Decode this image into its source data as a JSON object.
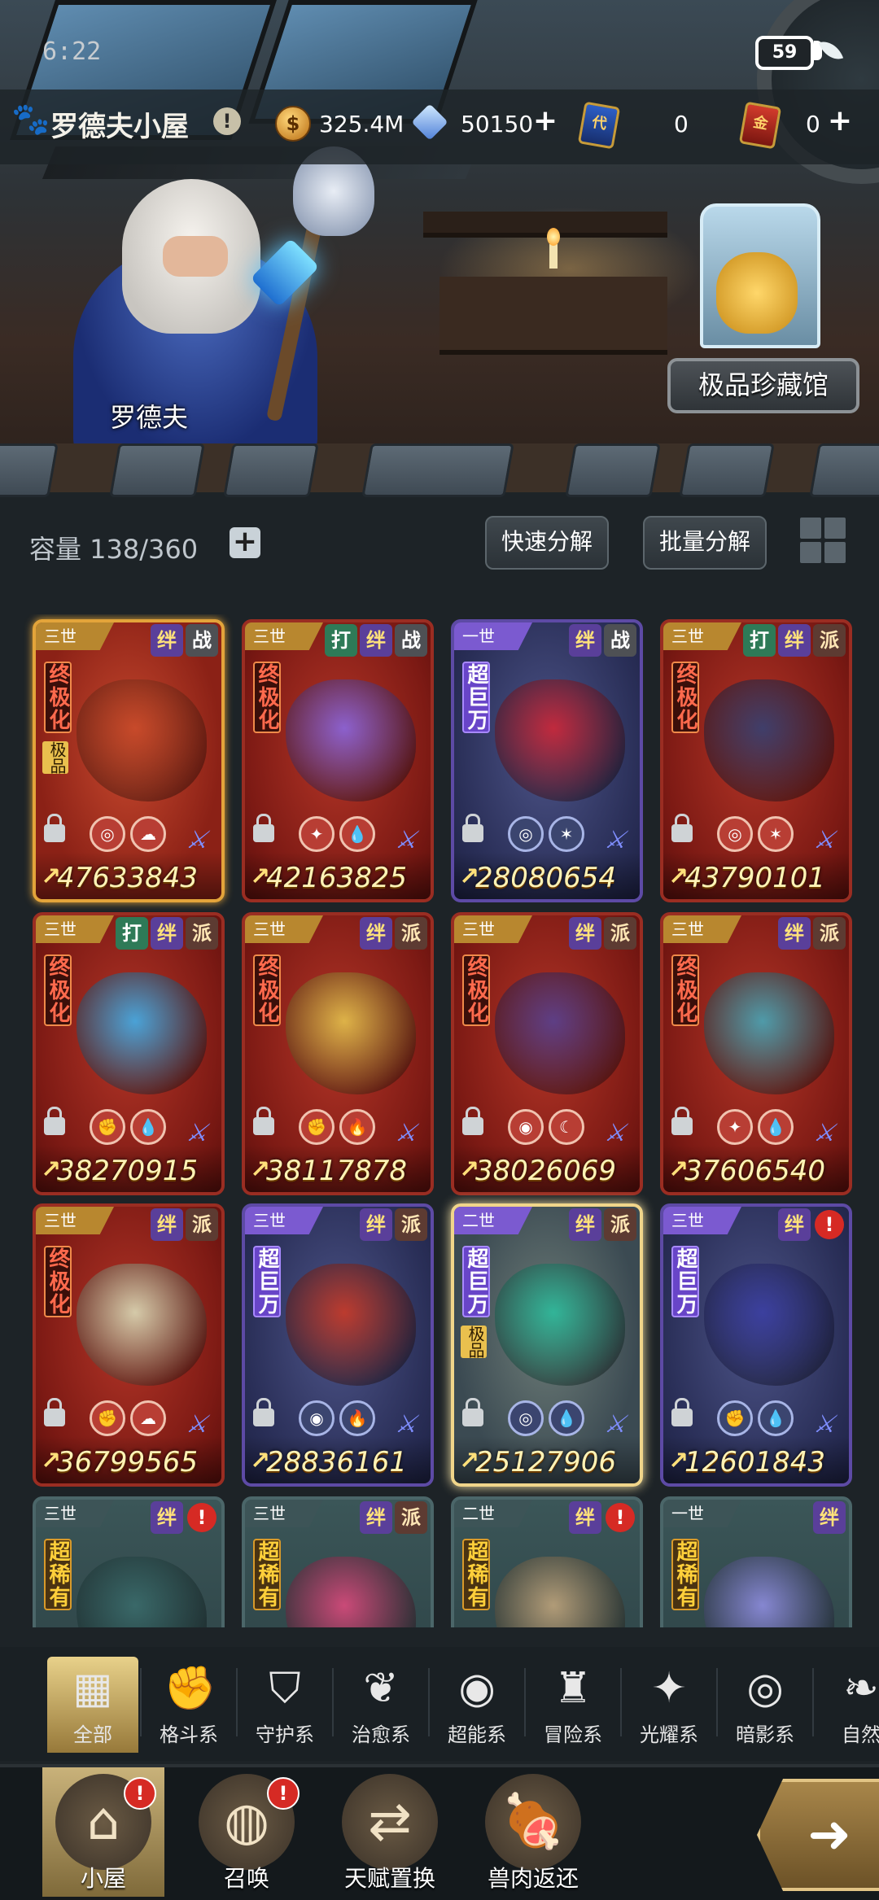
{
  "status_bar": {
    "time": "6:22",
    "battery": "59"
  },
  "header": {
    "room_title": "罗德夫小屋",
    "info_badge": "!",
    "gold": "325.4M",
    "crystals": "50150",
    "ticket_blue_label": "代",
    "ticket_blue_count": "0",
    "ticket_red_label": "金",
    "ticket_red_count": "0",
    "plus": "+"
  },
  "scene": {
    "npc_name": "罗德夫",
    "museum_button": "极品珍藏馆"
  },
  "inventory": {
    "capacity_label": "容量 138/360",
    "add": "+",
    "quick_decompose": "快速分解",
    "batch_decompose": "批量分解"
  },
  "tag_labels": {
    "ban": "绊",
    "zhan": "战",
    "da": "打",
    "pai": "派",
    "alert": "!"
  },
  "rarity_labels": {
    "ultimate": "终极化",
    "super": "超巨万",
    "rare": "超稀有"
  },
  "cards": [
    {
      "era": "三世",
      "rarity": "终极化",
      "quality": "极品",
      "tags": [
        "绊",
        "战"
      ],
      "power": "47633843",
      "elements": [
        "◎",
        "☁"
      ],
      "color": "gold",
      "creature_color": "#c84a2a"
    },
    {
      "era": "三世",
      "rarity": "终极化",
      "tags": [
        "打",
        "绊",
        "战"
      ],
      "power": "42163825",
      "elements": [
        "✦",
        "💧"
      ],
      "color": "red",
      "creature_color": "#8a63d6"
    },
    {
      "era": "一世",
      "rarity": "超巨万",
      "tags": [
        "绊",
        "战"
      ],
      "power": "28080654",
      "elements": [
        "◎",
        "✶"
      ],
      "color": "purple",
      "creature_color": "#c7283a"
    },
    {
      "era": "三世",
      "rarity": "终极化",
      "tags": [
        "打",
        "绊",
        "派"
      ],
      "power": "43790101",
      "elements": [
        "◎",
        "✶"
      ],
      "color": "red",
      "creature_color": "#3a3f6e"
    },
    {
      "era": "三世",
      "rarity": "终极化",
      "tags": [
        "打",
        "绊",
        "派"
      ],
      "power": "38270915",
      "elements": [
        "✊",
        "💧"
      ],
      "color": "red",
      "creature_color": "#45a8e0"
    },
    {
      "era": "三世",
      "rarity": "终极化",
      "tags": [
        "绊",
        "派"
      ],
      "power": "38117878",
      "elements": [
        "✊",
        "🔥"
      ],
      "color": "red",
      "creature_color": "#e0b94a"
    },
    {
      "era": "三世",
      "rarity": "终极化",
      "tags": [
        "绊",
        "派"
      ],
      "power": "38026069",
      "elements": [
        "◉",
        "☾"
      ],
      "color": "red",
      "creature_color": "#5a3f8a"
    },
    {
      "era": "三世",
      "rarity": "终极化",
      "tags": [
        "绊",
        "派"
      ],
      "power": "37606540",
      "elements": [
        "✦",
        "💧"
      ],
      "color": "red",
      "creature_color": "#4aa0b0"
    },
    {
      "era": "三世",
      "rarity": "终极化",
      "tags": [
        "绊",
        "派"
      ],
      "power": "36799565",
      "elements": [
        "✊",
        "☁"
      ],
      "color": "red",
      "creature_color": "#d7d2b0"
    },
    {
      "era": "三世",
      "rarity": "超巨万",
      "tags": [
        "绊",
        "派"
      ],
      "power": "28836161",
      "elements": [
        "◉",
        "🔥"
      ],
      "color": "purple",
      "creature_color": "#c23a2a"
    },
    {
      "era": "二世",
      "rarity": "超巨万",
      "quality": "极品",
      "tags": [
        "绊",
        "派"
      ],
      "power": "25127906",
      "elements": [
        "◎",
        "💧"
      ],
      "color": "lightgold",
      "creature_color": "#2fb89a"
    },
    {
      "era": "三世",
      "rarity": "超巨万",
      "tags": [
        "绊",
        "!"
      ],
      "power": "12601843",
      "elements": [
        "✊",
        "💧"
      ],
      "color": "purple",
      "creature_color": "#3b3fa0"
    },
    {
      "era": "三世",
      "rarity": "超稀有",
      "tags": [
        "绊",
        "!"
      ],
      "power": "",
      "elements": [],
      "color": "teal",
      "creature_color": "#3a6a6a"
    },
    {
      "era": "三世",
      "rarity": "超稀有",
      "tags": [
        "绊",
        "派"
      ],
      "power": "",
      "elements": [],
      "color": "teal",
      "creature_color": "#d24a7a"
    },
    {
      "era": "二世",
      "rarity": "超稀有",
      "tags": [
        "绊",
        "!"
      ],
      "power": "",
      "elements": [],
      "color": "teal",
      "creature_color": "#b8a07a"
    },
    {
      "era": "一世",
      "rarity": "超稀有",
      "tags": [
        "绊"
      ],
      "power": "",
      "elements": [],
      "color": "teal",
      "creature_color": "#8a8ad8"
    }
  ],
  "category_tabs": [
    {
      "label": "全部",
      "icon": "all-icon",
      "glyph": "▦",
      "active": true
    },
    {
      "label": "格斗系",
      "icon": "fist-icon",
      "glyph": "✊"
    },
    {
      "label": "守护系",
      "icon": "shield-icon",
      "glyph": "⛉"
    },
    {
      "label": "治愈系",
      "icon": "sprout-icon",
      "glyph": "❦"
    },
    {
      "label": "超能系",
      "icon": "alien-icon",
      "glyph": "◉"
    },
    {
      "label": "冒险系",
      "icon": "tower-icon",
      "glyph": "♜"
    },
    {
      "label": "光耀系",
      "icon": "sun-icon",
      "glyph": "✦"
    },
    {
      "label": "暗影系",
      "icon": "eye-icon",
      "glyph": "◎"
    },
    {
      "label": "自然",
      "icon": "leaf-icon",
      "glyph": "❧"
    }
  ],
  "bottom_nav": [
    {
      "label": "小屋",
      "icon": "house-icon",
      "glyph": "⌂",
      "active": true,
      "alert": "!"
    },
    {
      "label": "召唤",
      "icon": "egg-icon",
      "glyph": "◍",
      "alert": "!"
    },
    {
      "label": "天赋置换",
      "icon": "swap-icon",
      "glyph": "⇄"
    },
    {
      "label": "兽肉返还",
      "icon": "meat-icon",
      "glyph": "🍖"
    }
  ],
  "go_arrow": "➜"
}
